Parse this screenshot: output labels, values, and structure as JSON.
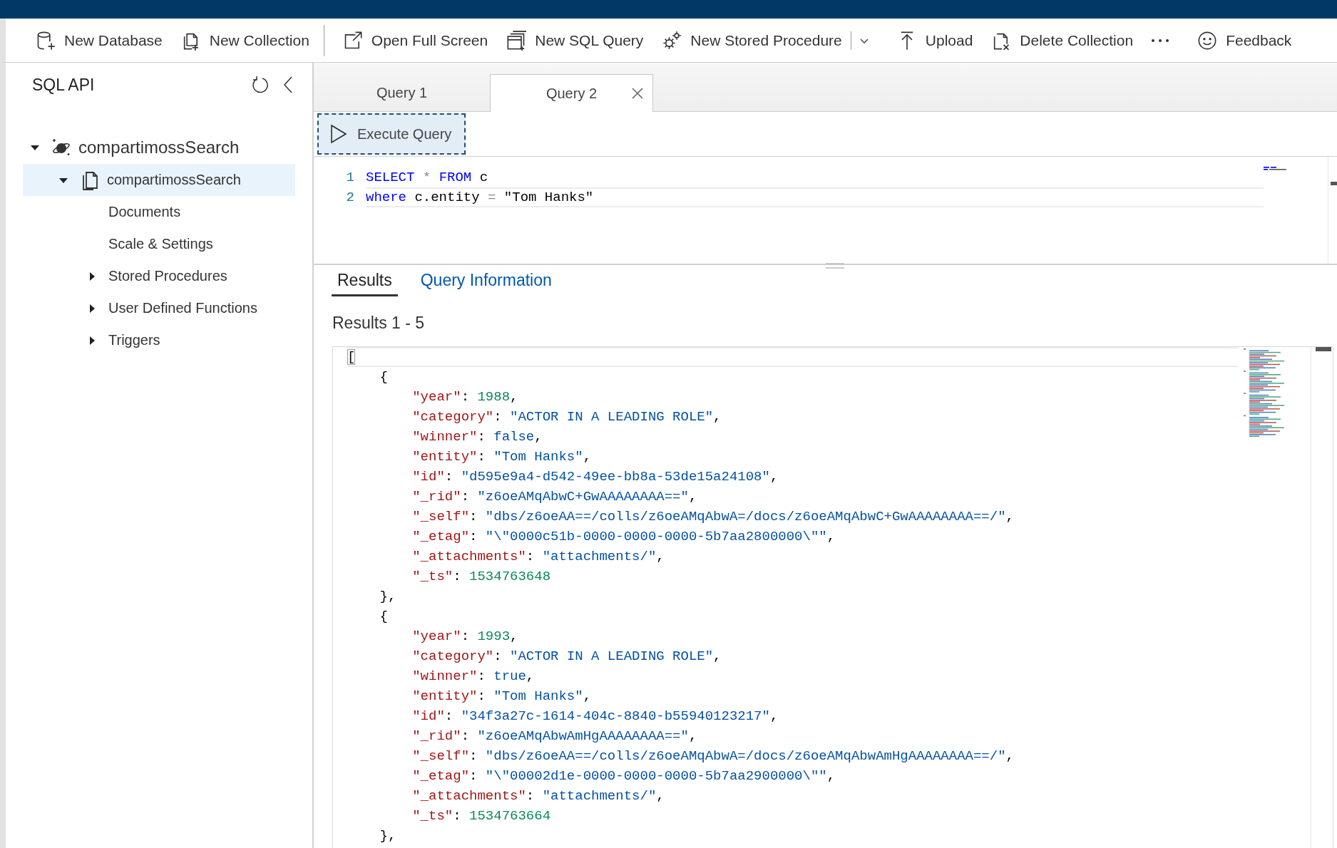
{
  "toolbar": {
    "items": [
      {
        "kind": "button",
        "label": "New Database"
      },
      {
        "kind": "button",
        "label": "New Collection"
      },
      {
        "kind": "separator"
      },
      {
        "kind": "button",
        "label": "Open Full Screen"
      },
      {
        "kind": "button",
        "label": "New SQL Query"
      },
      {
        "kind": "button",
        "label": "New Stored Procedure"
      },
      {
        "kind": "separator"
      },
      {
        "kind": "dropdown"
      },
      {
        "kind": "button",
        "label": "Upload"
      },
      {
        "kind": "button",
        "label": "Delete Collection"
      },
      {
        "kind": "overflow"
      },
      {
        "kind": "button",
        "label": "Feedback"
      }
    ]
  },
  "sidebar": {
    "title": "SQL API",
    "tree": [
      {
        "label": "compartimossSearch",
        "expanded": true,
        "selected": false,
        "children": [
          {
            "label": "compartimossSearch",
            "expanded": true,
            "selected": true,
            "children": [
              {
                "label": "Documents",
                "selected": false
              },
              {
                "label": "Scale & Settings",
                "selected": false
              },
              {
                "label": "Stored Procedures",
                "expanded": false,
                "selected": false
              },
              {
                "label": "User Defined Functions",
                "expanded": false,
                "selected": false
              },
              {
                "label": "Triggers",
                "expanded": false,
                "selected": false
              }
            ]
          }
        ]
      }
    ]
  },
  "query_tabs": [
    {
      "label": "Query 1",
      "selected": false
    },
    {
      "label": "Query 2",
      "selected": true
    }
  ],
  "execute_button": {
    "label": "Execute Query"
  },
  "query_editor": {
    "lines": [
      {
        "number": "1",
        "active": false,
        "tokens": [
          {
            "kind": "keyword",
            "text": "SELECT"
          },
          {
            "kind": "operator",
            "text": " * "
          },
          {
            "kind": "keyword",
            "text": "FROM"
          },
          {
            "kind": "plain",
            "text": " c"
          }
        ]
      },
      {
        "number": "2",
        "active": true,
        "tokens": [
          {
            "kind": "keyword",
            "text": "where"
          },
          {
            "kind": "plain",
            "text": " c.entity "
          },
          {
            "kind": "operator",
            "text": "="
          },
          {
            "kind": "plain",
            "text": " \"Tom Hanks\""
          }
        ]
      }
    ]
  },
  "result_tabs": [
    {
      "label": "Results",
      "selected": true
    },
    {
      "label": "Query Information",
      "selected": false
    }
  ],
  "results_heading": "Results 1 - 5",
  "results_editor": {
    "lines": [
      {
        "active": true,
        "tokens": [
          {
            "kind": "bracket_match",
            "text": "["
          }
        ]
      },
      {
        "active": false,
        "tokens": [
          {
            "kind": "punct",
            "text": "    {"
          }
        ]
      },
      {
        "active": false,
        "tokens": [
          {
            "kind": "key",
            "text": "        \"year\""
          },
          {
            "kind": "punct",
            "text": ": "
          },
          {
            "kind": "number",
            "text": "1988"
          },
          {
            "kind": "punct",
            "text": ","
          }
        ]
      },
      {
        "active": false,
        "tokens": [
          {
            "kind": "key",
            "text": "        \"category\""
          },
          {
            "kind": "punct",
            "text": ": "
          },
          {
            "kind": "string",
            "text": "\"ACTOR IN A LEADING ROLE\""
          },
          {
            "kind": "punct",
            "text": ","
          }
        ]
      },
      {
        "active": false,
        "tokens": [
          {
            "kind": "key",
            "text": "        \"winner\""
          },
          {
            "kind": "punct",
            "text": ": "
          },
          {
            "kind": "literal",
            "text": "false"
          },
          {
            "kind": "punct",
            "text": ","
          }
        ]
      },
      {
        "active": false,
        "tokens": [
          {
            "kind": "key",
            "text": "        \"entity\""
          },
          {
            "kind": "punct",
            "text": ": "
          },
          {
            "kind": "string",
            "text": "\"Tom Hanks\""
          },
          {
            "kind": "punct",
            "text": ","
          }
        ]
      },
      {
        "active": false,
        "tokens": [
          {
            "kind": "key",
            "text": "        \"id\""
          },
          {
            "kind": "punct",
            "text": ": "
          },
          {
            "kind": "string",
            "text": "\"d595e9a4-d542-49ee-bb8a-53de15a24108\""
          },
          {
            "kind": "punct",
            "text": ","
          }
        ]
      },
      {
        "active": false,
        "tokens": [
          {
            "kind": "key",
            "text": "        \"_rid\""
          },
          {
            "kind": "punct",
            "text": ": "
          },
          {
            "kind": "string",
            "text": "\"z6oeAMqAbwC+GwAAAAAAAA==\""
          },
          {
            "kind": "punct",
            "text": ","
          }
        ]
      },
      {
        "active": false,
        "tokens": [
          {
            "kind": "key",
            "text": "        \"_self\""
          },
          {
            "kind": "punct",
            "text": ": "
          },
          {
            "kind": "string",
            "text": "\"dbs/z6oeAA==/colls/z6oeAMqAbwA=/docs/z6oeAMqAbwC+GwAAAAAAAA==/\""
          },
          {
            "kind": "punct",
            "text": ","
          }
        ]
      },
      {
        "active": false,
        "tokens": [
          {
            "kind": "key",
            "text": "        \"_etag\""
          },
          {
            "kind": "punct",
            "text": ": "
          },
          {
            "kind": "string",
            "text": "\"\\\"0000c51b-0000-0000-0000-5b7aa2800000\\\"\""
          },
          {
            "kind": "punct",
            "text": ","
          }
        ]
      },
      {
        "active": false,
        "tokens": [
          {
            "kind": "key",
            "text": "        \"_attachments\""
          },
          {
            "kind": "punct",
            "text": ": "
          },
          {
            "kind": "string",
            "text": "\"attachments/\""
          },
          {
            "kind": "punct",
            "text": ","
          }
        ]
      },
      {
        "active": false,
        "tokens": [
          {
            "kind": "key",
            "text": "        \"_ts\""
          },
          {
            "kind": "punct",
            "text": ": "
          },
          {
            "kind": "number",
            "text": "1534763648"
          }
        ]
      },
      {
        "active": false,
        "tokens": [
          {
            "kind": "punct",
            "text": "    },"
          }
        ]
      },
      {
        "active": false,
        "tokens": [
          {
            "kind": "punct",
            "text": "    {"
          }
        ]
      },
      {
        "active": false,
        "tokens": [
          {
            "kind": "key",
            "text": "        \"year\""
          },
          {
            "kind": "punct",
            "text": ": "
          },
          {
            "kind": "number",
            "text": "1993"
          },
          {
            "kind": "punct",
            "text": ","
          }
        ]
      },
      {
        "active": false,
        "tokens": [
          {
            "kind": "key",
            "text": "        \"category\""
          },
          {
            "kind": "punct",
            "text": ": "
          },
          {
            "kind": "string",
            "text": "\"ACTOR IN A LEADING ROLE\""
          },
          {
            "kind": "punct",
            "text": ","
          }
        ]
      },
      {
        "active": false,
        "tokens": [
          {
            "kind": "key",
            "text": "        \"winner\""
          },
          {
            "kind": "punct",
            "text": ": "
          },
          {
            "kind": "literal",
            "text": "true"
          },
          {
            "kind": "punct",
            "text": ","
          }
        ]
      },
      {
        "active": false,
        "tokens": [
          {
            "kind": "key",
            "text": "        \"entity\""
          },
          {
            "kind": "punct",
            "text": ": "
          },
          {
            "kind": "string",
            "text": "\"Tom Hanks\""
          },
          {
            "kind": "punct",
            "text": ","
          }
        ]
      },
      {
        "active": false,
        "tokens": [
          {
            "kind": "key",
            "text": "        \"id\""
          },
          {
            "kind": "punct",
            "text": ": "
          },
          {
            "kind": "string",
            "text": "\"34f3a27c-1614-404c-8840-b55940123217\""
          },
          {
            "kind": "punct",
            "text": ","
          }
        ]
      },
      {
        "active": false,
        "tokens": [
          {
            "kind": "key",
            "text": "        \"_rid\""
          },
          {
            "kind": "punct",
            "text": ": "
          },
          {
            "kind": "string",
            "text": "\"z6oeAMqAbwAmHgAAAAAAAA==\""
          },
          {
            "kind": "punct",
            "text": ","
          }
        ]
      },
      {
        "active": false,
        "tokens": [
          {
            "kind": "key",
            "text": "        \"_self\""
          },
          {
            "kind": "punct",
            "text": ": "
          },
          {
            "kind": "string",
            "text": "\"dbs/z6oeAA==/colls/z6oeAMqAbwA=/docs/z6oeAMqAbwAmHgAAAAAAAA==/\""
          },
          {
            "kind": "punct",
            "text": ","
          }
        ]
      },
      {
        "active": false,
        "tokens": [
          {
            "kind": "key",
            "text": "        \"_etag\""
          },
          {
            "kind": "punct",
            "text": ": "
          },
          {
            "kind": "string",
            "text": "\"\\\"00002d1e-0000-0000-0000-5b7aa2900000\\\"\""
          },
          {
            "kind": "punct",
            "text": ","
          }
        ]
      },
      {
        "active": false,
        "tokens": [
          {
            "kind": "key",
            "text": "        \"_attachments\""
          },
          {
            "kind": "punct",
            "text": ": "
          },
          {
            "kind": "string",
            "text": "\"attachments/\""
          },
          {
            "kind": "punct",
            "text": ","
          }
        ]
      },
      {
        "active": false,
        "tokens": [
          {
            "kind": "key",
            "text": "        \"_ts\""
          },
          {
            "kind": "punct",
            "text": ": "
          },
          {
            "kind": "number",
            "text": "1534763664"
          }
        ]
      },
      {
        "active": false,
        "tokens": [
          {
            "kind": "punct",
            "text": "    },"
          }
        ]
      }
    ]
  }
}
